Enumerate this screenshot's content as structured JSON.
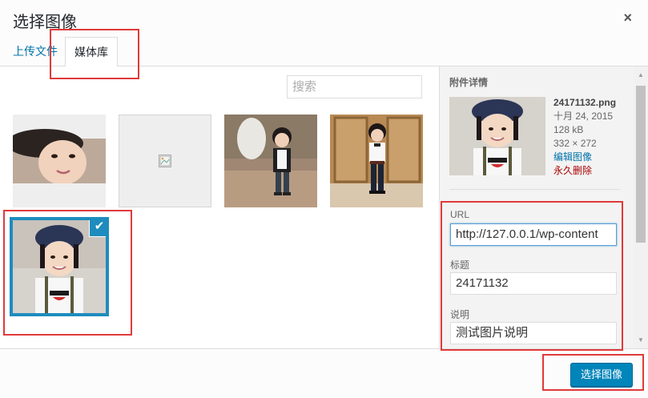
{
  "modal": {
    "title": "选择图像",
    "close_symbol": "×"
  },
  "tabs": [
    {
      "label": "上传文件"
    },
    {
      "label": "媒体库"
    }
  ],
  "search": {
    "placeholder": "搜索"
  },
  "attachments": [
    {
      "icon": "image-thumbnail",
      "description": "smiling girl close-up crop"
    },
    {
      "icon": "broken-image-icon"
    },
    {
      "icon": "image-thumbnail",
      "description": "girl standing outdoors"
    },
    {
      "icon": "image-thumbnail",
      "description": "girl standing by wooden door"
    },
    {
      "icon": "image-thumbnail",
      "description": "girl with cap, selected",
      "selected": true,
      "check_symbol": "✔"
    }
  ],
  "details": {
    "heading": "附件详情",
    "filename": "24171132.png",
    "date": "十月 24, 2015",
    "size": "128 kB",
    "dimensions": "332 × 272",
    "edit_link": "编辑图像",
    "delete_link": "永久删除",
    "url_label": "URL",
    "url_value": "http://127.0.0.1/wp-content",
    "title_label": "标题",
    "title_value": "24171132",
    "caption_label": "说明",
    "caption_value": "测试图片说明"
  },
  "toolbar": {
    "select_label": "选择图像"
  },
  "colors": {
    "accent": "#0085ba",
    "selected_border": "#1e8cbe",
    "highlight": "#e03a3a",
    "link": "#0073aa",
    "delete": "#aa0000"
  }
}
